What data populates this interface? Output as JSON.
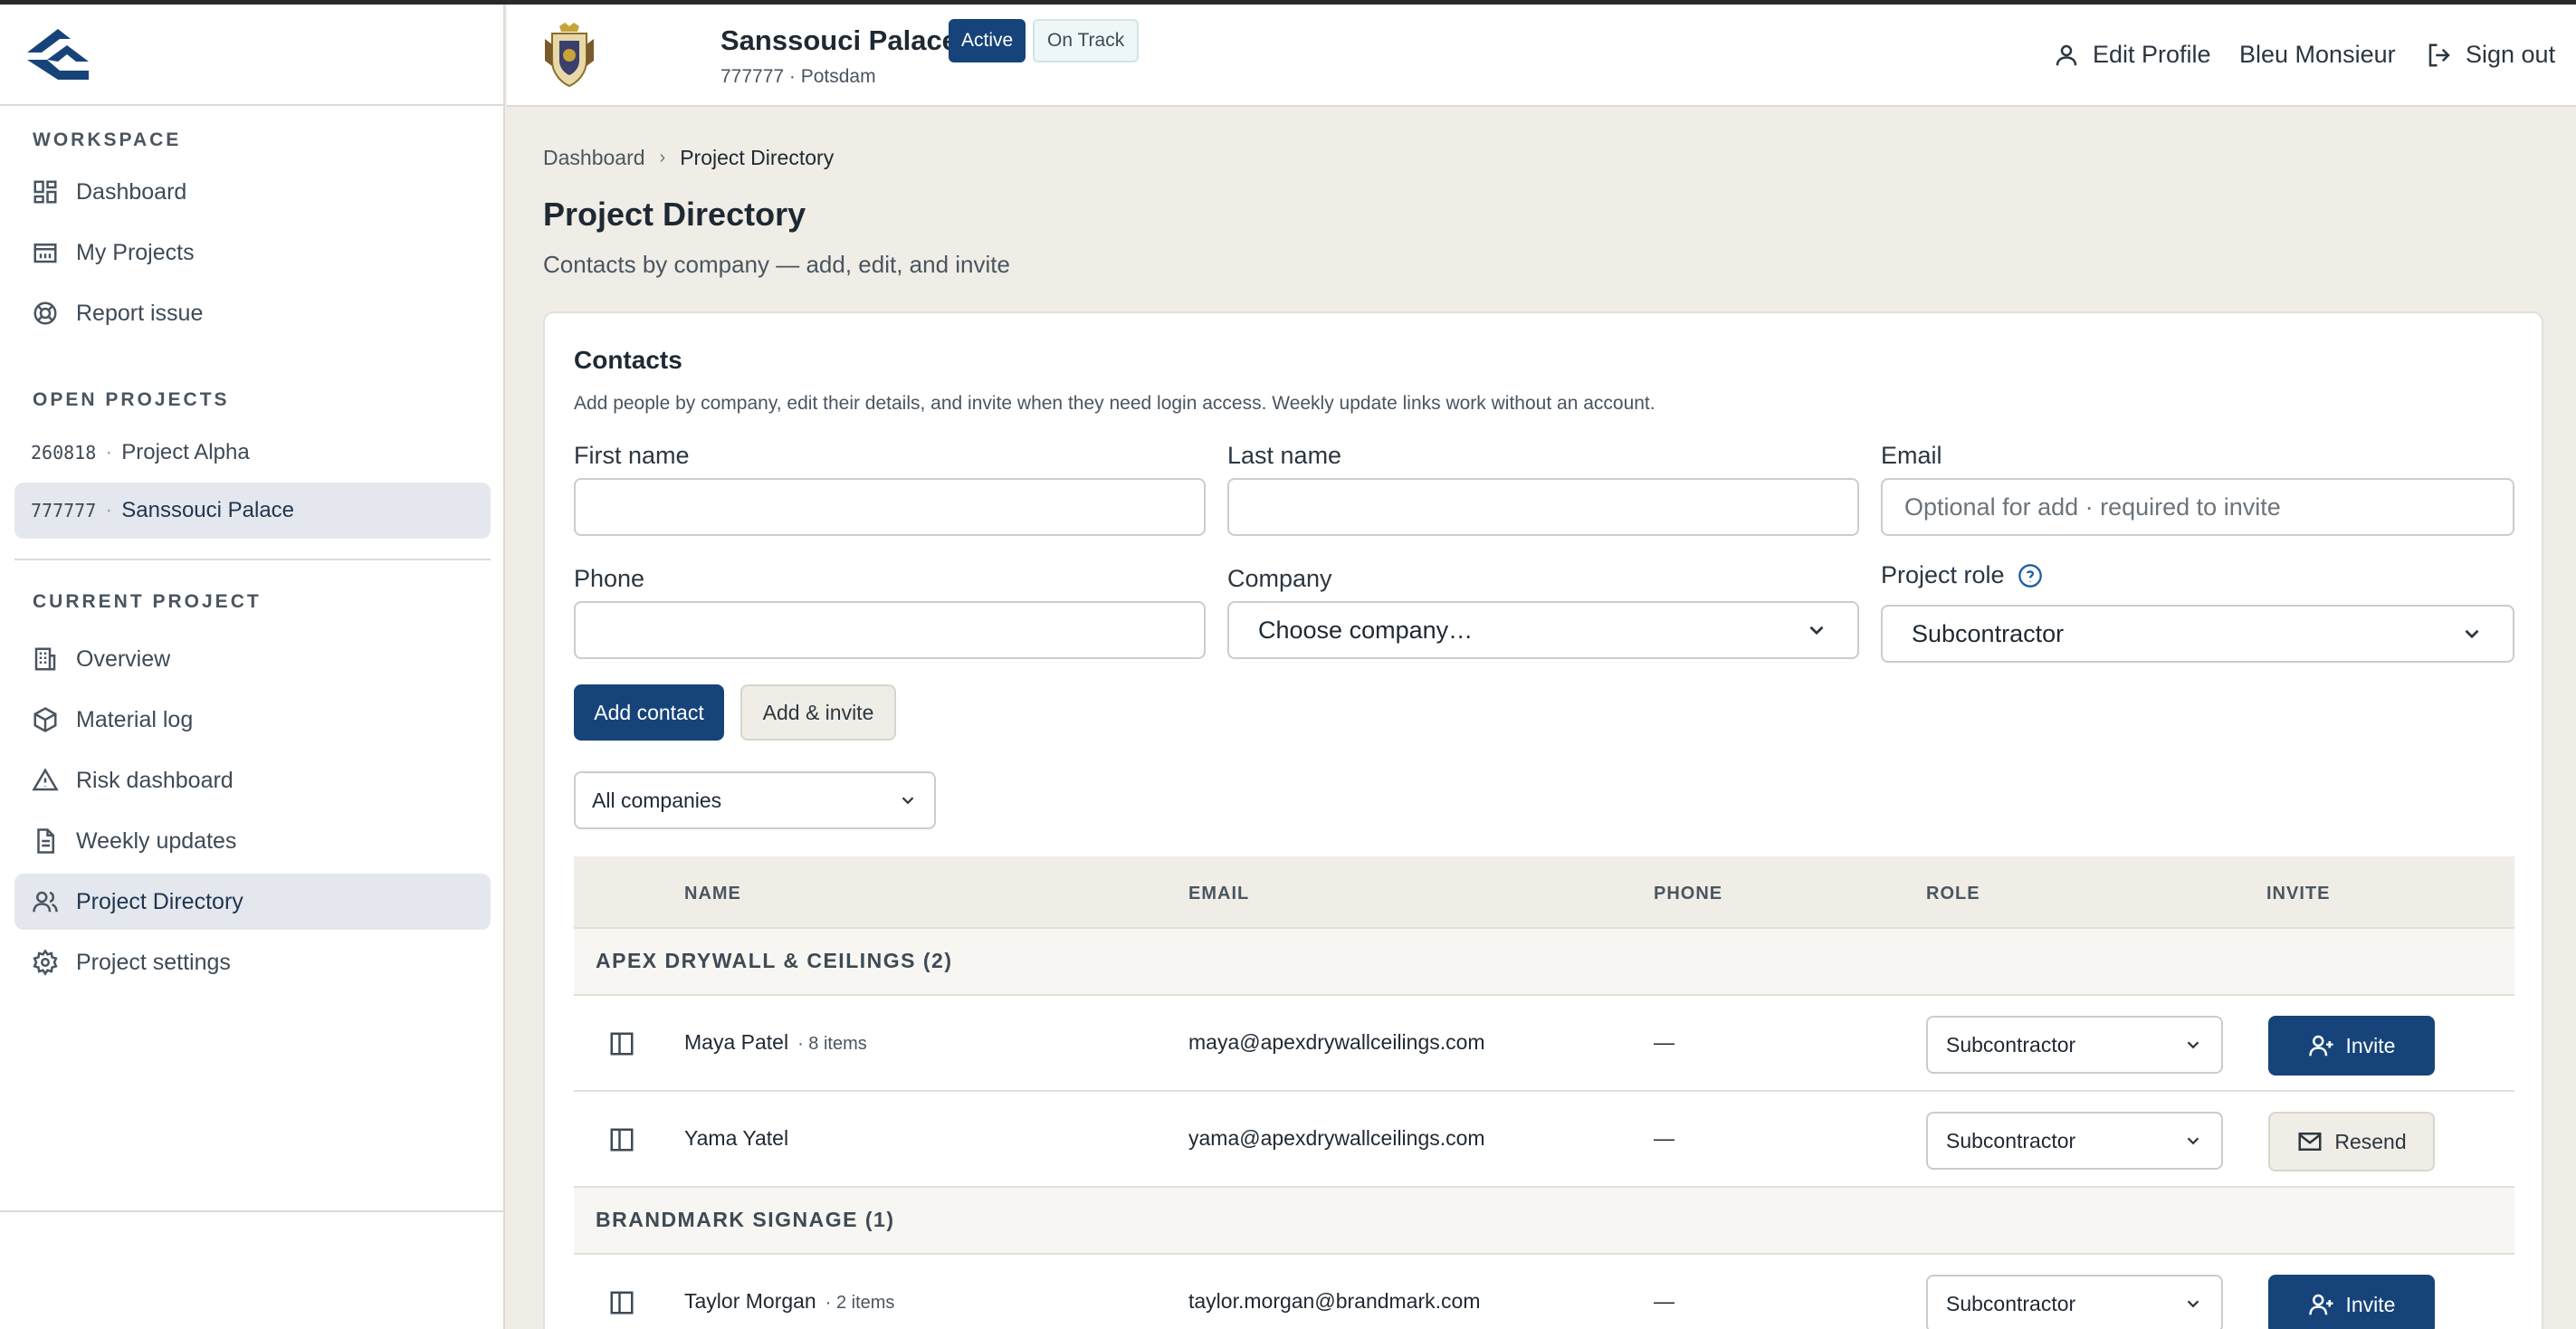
{
  "header": {
    "project_name": "Sanssouci Palace",
    "project_sub": "777777 · Potsdam",
    "badge_status": "Active",
    "badge_health": "On Track",
    "edit_profile": "Edit Profile",
    "user_name": "Bleu Monsieur",
    "sign_out": "Sign out"
  },
  "sidebar": {
    "workspace_label": "WORKSPACE",
    "workspace_items": [
      {
        "label": "Dashboard",
        "icon": "dashboard-icon"
      },
      {
        "label": "My Projects",
        "icon": "projects-icon"
      },
      {
        "label": "Report issue",
        "icon": "lifebuoy-icon"
      }
    ],
    "open_projects_label": "OPEN PROJECTS",
    "open_projects": [
      {
        "code": "260818",
        "name": "Project Alpha"
      },
      {
        "code": "777777",
        "name": "Sanssouci Palace"
      }
    ],
    "current_project_label": "CURRENT PROJECT",
    "current_items": [
      {
        "label": "Overview",
        "icon": "building-icon"
      },
      {
        "label": "Material log",
        "icon": "box-icon"
      },
      {
        "label": "Risk dashboard",
        "icon": "warning-icon"
      },
      {
        "label": "Weekly updates",
        "icon": "document-icon"
      },
      {
        "label": "Project Directory",
        "icon": "users-icon"
      },
      {
        "label": "Project settings",
        "icon": "gear-icon"
      }
    ]
  },
  "breadcrumb": {
    "home": "Dashboard",
    "current": "Project Directory"
  },
  "page": {
    "title": "Project Directory",
    "subtitle": "Contacts by company — add, edit, and invite"
  },
  "contacts_form": {
    "title": "Contacts",
    "description": "Add people by company, edit their details, and invite when they need login access. Weekly update links work without an account.",
    "first_name_label": "First name",
    "first_name_value": "",
    "last_name_label": "Last name",
    "last_name_value": "",
    "email_label": "Email",
    "email_placeholder": "Optional for add · required to invite",
    "phone_label": "Phone",
    "phone_value": "",
    "company_label": "Company",
    "company_value": "Choose company…",
    "role_label": "Project role",
    "role_value": "Subcontractor",
    "add_button": "Add contact",
    "add_invite_button": "Add & invite"
  },
  "filter": {
    "value": "All companies"
  },
  "table": {
    "columns": [
      "NAME",
      "EMAIL",
      "PHONE",
      "ROLE",
      "INVITE"
    ],
    "groups": [
      {
        "label": "APEX DRYWALL & CEILINGS (2)",
        "rows": [
          {
            "name": "Maya Patel",
            "meta": "· 8 items",
            "email": "maya@apexdrywallceilings.com",
            "phone": "—",
            "role": "Subcontractor",
            "action": "Invite"
          },
          {
            "name": "Yama Yatel",
            "meta": "",
            "email": "yama@apexdrywallceilings.com",
            "phone": "—",
            "role": "Subcontractor",
            "action": "Resend"
          }
        ]
      },
      {
        "label": "BRANDMARK SIGNAGE (1)",
        "rows": [
          {
            "name": "Taylor Morgan",
            "meta": "· 2 items",
            "email": "taylor.morgan@brandmark.com",
            "phone": "—",
            "role": "Subcontractor",
            "action": "Invite"
          }
        ]
      }
    ]
  },
  "colors": {
    "primary": "#16447a",
    "accent": "#c6632f",
    "background": "#efede6"
  }
}
